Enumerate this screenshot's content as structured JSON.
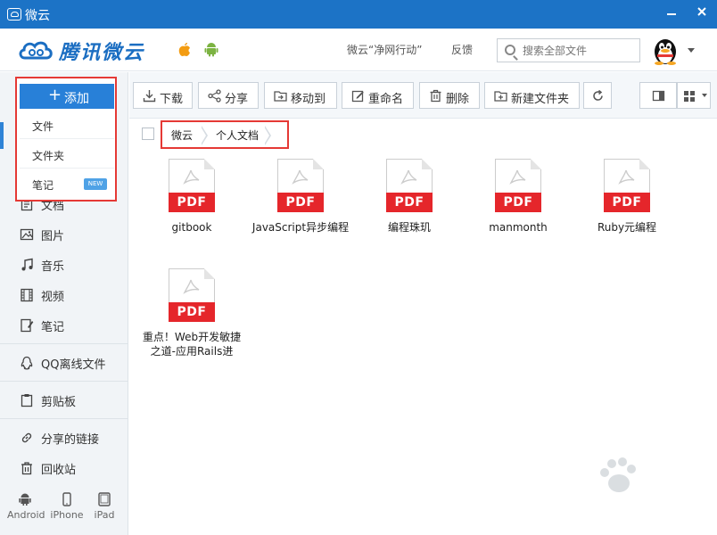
{
  "window": {
    "title": "微云",
    "app_icon": "cloud-app-icon"
  },
  "header": {
    "logo_text": "腾讯微云",
    "promo_link": "微云“净网行动”",
    "feedback": "反馈",
    "search_placeholder": "搜索全部文件"
  },
  "add_menu": {
    "button_label": "添加",
    "items": [
      {
        "label": "文件"
      },
      {
        "label": "文件夹"
      },
      {
        "label": "笔记",
        "badge": "NEW"
      }
    ]
  },
  "sidebar": {
    "items": [
      {
        "label": "文档",
        "icon": "document-icon"
      },
      {
        "label": "图片",
        "icon": "image-icon"
      },
      {
        "label": "音乐",
        "icon": "music-icon"
      },
      {
        "label": "视频",
        "icon": "video-icon"
      },
      {
        "label": "笔记",
        "icon": "note-icon"
      },
      {
        "label": "QQ离线文件",
        "icon": "qq-icon"
      },
      {
        "label": "剪贴板",
        "icon": "clipboard-icon"
      },
      {
        "label": "分享的链接",
        "icon": "link-icon"
      },
      {
        "label": "回收站",
        "icon": "trash-icon"
      }
    ],
    "devices": [
      {
        "label": "Android",
        "icon": "android-icon"
      },
      {
        "label": "iPhone",
        "icon": "iphone-icon"
      },
      {
        "label": "iPad",
        "icon": "ipad-icon"
      }
    ]
  },
  "toolbar": {
    "download": "下载",
    "share": "分享",
    "move_to": "移动到",
    "rename": "重命名",
    "delete": "删除",
    "new_folder": "新建文件夹"
  },
  "breadcrumb": [
    "微云",
    "个人文档"
  ],
  "files": [
    {
      "name": "gitbook",
      "type": "PDF"
    },
    {
      "name": "JavaScript异步编程",
      "type": "PDF"
    },
    {
      "name": "编程珠玑",
      "type": "PDF"
    },
    {
      "name": "manmonth",
      "type": "PDF"
    },
    {
      "name": "Ruby元编程",
      "type": "PDF"
    },
    {
      "name": "重点！Web开发敏捷之道-应用Rails进",
      "type": "PDF"
    }
  ],
  "colors": {
    "titlebar": "#1c73c6",
    "accent": "#2880d8",
    "pdf_red": "#e5262b",
    "highlight_box": "#e53935"
  }
}
